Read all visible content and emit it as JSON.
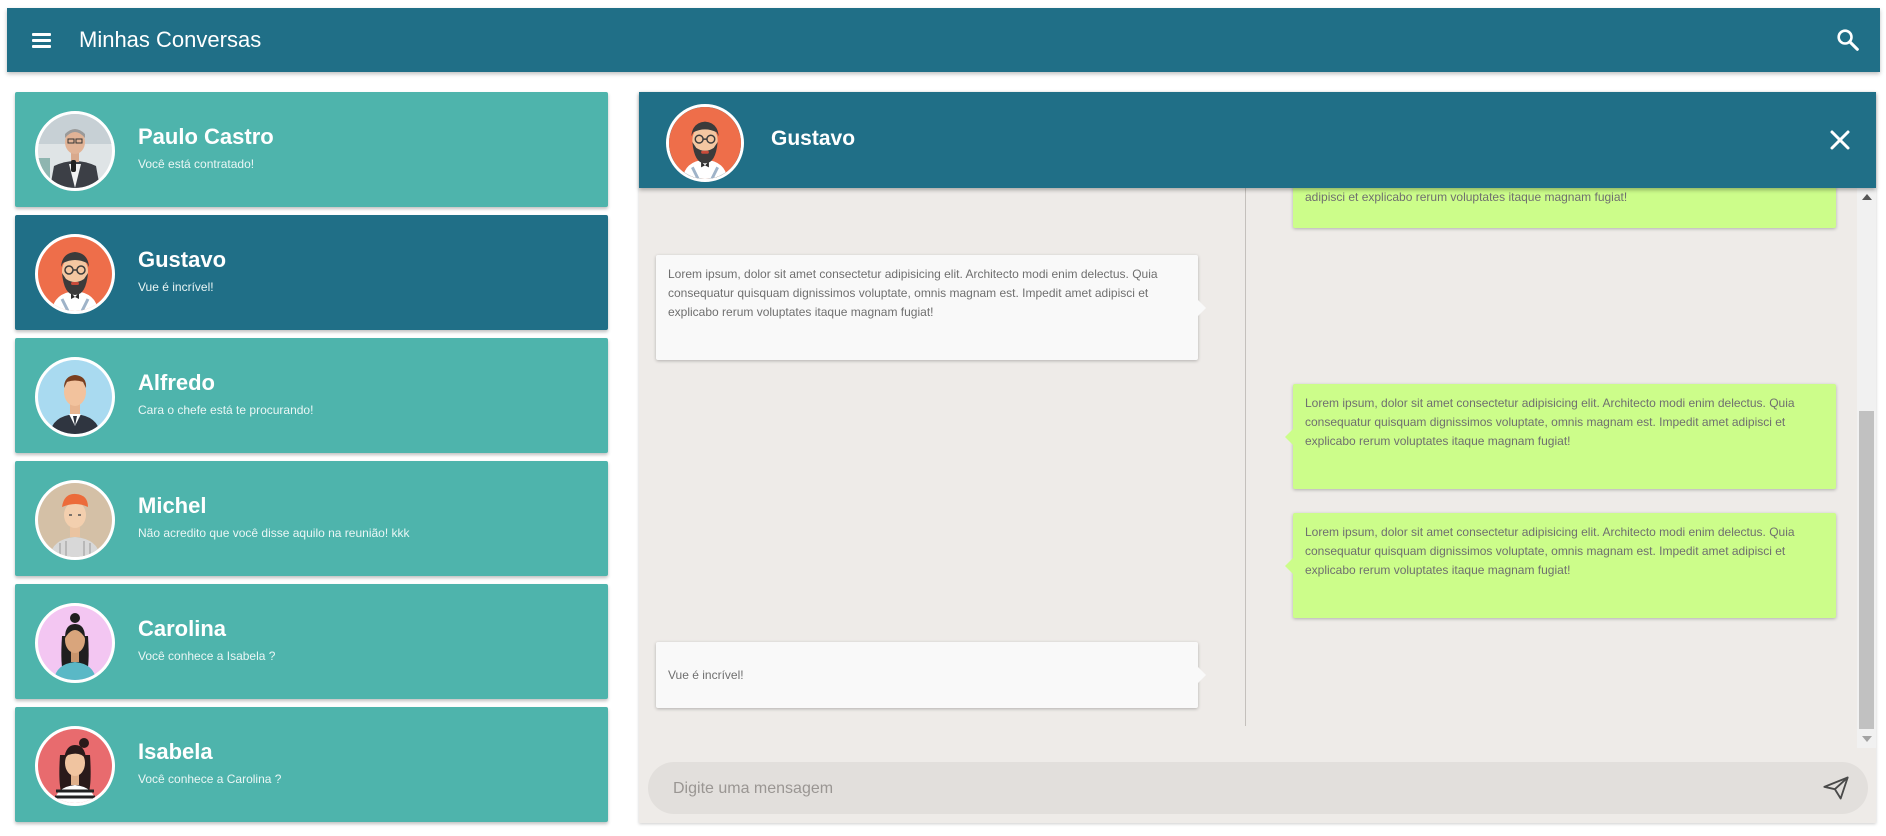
{
  "app": {
    "title": "Minhas Conversas",
    "menu_icon": "menu-icon",
    "search_icon": "search-icon"
  },
  "colors": {
    "primary": "#206f87",
    "contact_bg": "#4eb4ac",
    "sent_bubble": "#ccfd8a",
    "received_bubble": "#f9f9f9",
    "chat_bg": "#eeebe8"
  },
  "contacts": [
    {
      "name": "Paulo Castro",
      "preview": "Você está contratado!",
      "avatar": "avatar-paulo",
      "active": false
    },
    {
      "name": "Gustavo",
      "preview": "Vue é incrível!",
      "avatar": "avatar-gustavo",
      "active": true
    },
    {
      "name": "Alfredo",
      "preview": "Cara o chefe está te procurando!",
      "avatar": "avatar-alfredo",
      "active": false
    },
    {
      "name": "Michel",
      "preview": "Não acredito que você disse aquilo na reunião! kkk",
      "avatar": "avatar-michel",
      "active": false
    },
    {
      "name": "Carolina",
      "preview": "Você conhece a Isabela ?",
      "avatar": "avatar-carolina",
      "active": false
    },
    {
      "name": "Isabela",
      "preview": "Você conhece a Carolina ?",
      "avatar": "avatar-isabela",
      "active": false
    }
  ],
  "chat": {
    "contact_name": "Gustavo",
    "close_icon": "close-icon",
    "messages": [
      {
        "direction": "out",
        "text": "adipisci et explicabo rerum voluptates itaque magnam fugiat!"
      },
      {
        "direction": "in",
        "text": "Lorem ipsum, dolor sit amet consectetur adipisicing elit. Architecto modi enim delectus. Quia consequatur quisquam dignissimos voluptate, omnis magnam est. Impedit amet adipisci et explicabo rerum voluptates itaque magnam fugiat!"
      },
      {
        "direction": "out",
        "text": "Lorem ipsum, dolor sit amet consectetur adipisicing elit. Architecto modi enim delectus. Quia consequatur quisquam dignissimos voluptate, omnis magnam est. Impedit amet adipisci et explicabo rerum voluptates itaque magnam fugiat!"
      },
      {
        "direction": "out",
        "text": "Lorem ipsum, dolor sit amet consectetur adipisicing elit. Architecto modi enim delectus. Quia consequatur quisquam dignissimos voluptate, omnis magnam est. Impedit amet adipisci et explicabo rerum voluptates itaque magnam fugiat!"
      },
      {
        "direction": "in",
        "text": "Vue é incrível!"
      }
    ],
    "input_placeholder": "Digite uma mensagem",
    "input_value": "",
    "send_icon": "send-icon"
  }
}
